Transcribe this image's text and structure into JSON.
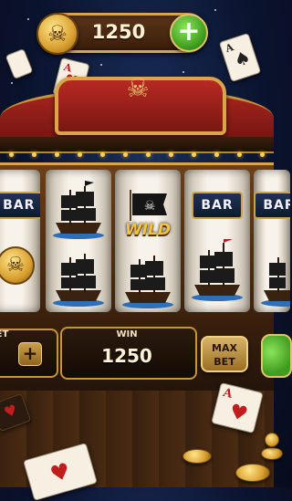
{
  "header": {
    "coin_balance": "1250",
    "add_coins_symbol": "+"
  },
  "reels": {
    "bar_label": "BAR",
    "wild_label": "WILD"
  },
  "controls": {
    "bet_label": "BET",
    "bet_plus_symbol": "+",
    "win_label": "WIN",
    "win_amount": "1250",
    "max_bet_line1": "MAX",
    "max_bet_line2": "BET"
  },
  "cards": {
    "ace_rank": "A",
    "heart": "♥",
    "spade": "♠"
  },
  "colors": {
    "gold": "#d8a548",
    "banner_red": "#a8251e",
    "wood": "#3a200c",
    "spin_green": "#3f9d1f"
  }
}
